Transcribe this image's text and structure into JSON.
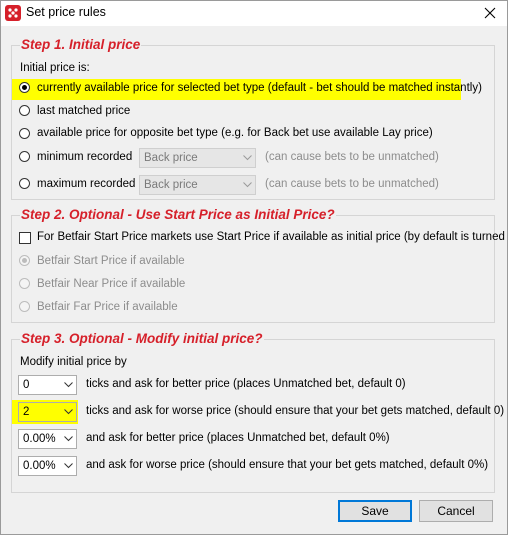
{
  "window": {
    "title": "Set price rules"
  },
  "step1": {
    "title": "Step 1. Initial price",
    "prompt": "Initial price is:",
    "options": [
      {
        "label": "currently available price for selected bet type (default - bet should be matched instantly)",
        "checked": true,
        "highlighted": true
      },
      {
        "label": "last matched price",
        "checked": false
      },
      {
        "label": "available price for opposite bet type (e.g. for Back bet use available Lay price)",
        "checked": false
      },
      {
        "label": "minimum recorded",
        "checked": false,
        "combo_value": "Back price",
        "hint": "(can cause bets to be unmatched)"
      },
      {
        "label": "maximum recorded",
        "checked": false,
        "combo_value": "Back price",
        "hint": "(can cause bets to be unmatched)"
      }
    ]
  },
  "step2": {
    "title": "Step 2. Optional - Use Start Price as Initial Price?",
    "checkbox_label": "For Betfair Start Price markets use Start Price if available as initial price (by default is turned off)",
    "checkbox_checked": false,
    "options": [
      {
        "label": "Betfair Start Price if available",
        "checked": true
      },
      {
        "label": "Betfair Near Price if available",
        "checked": false
      },
      {
        "label": "Betfair Far Price if available",
        "checked": false
      }
    ]
  },
  "step3": {
    "title": "Step 3. Optional - Modify initial price?",
    "prompt": "Modify initial price by",
    "rows": [
      {
        "value": "0",
        "label": "ticks and ask for better price (places Unmatched bet, default 0)"
      },
      {
        "value": "2",
        "label": "ticks and ask for worse price (should ensure that your bet gets matched, default 0)",
        "highlighted": true
      },
      {
        "value": "0.00%",
        "label": "and ask for better price (places Unmatched bet, default 0%)"
      },
      {
        "value": "0.00%",
        "label": "and ask for worse price (should ensure that your bet gets matched, default 0%)"
      }
    ]
  },
  "buttons": {
    "save": "Save",
    "cancel": "Cancel"
  },
  "colors": {
    "step_title": "#d6202a",
    "highlight": "#ffff00",
    "default_button_border": "#0078d7"
  },
  "icons": {
    "app": "app-icon",
    "close": "close-icon",
    "dropdown": "chevron-down-icon"
  }
}
